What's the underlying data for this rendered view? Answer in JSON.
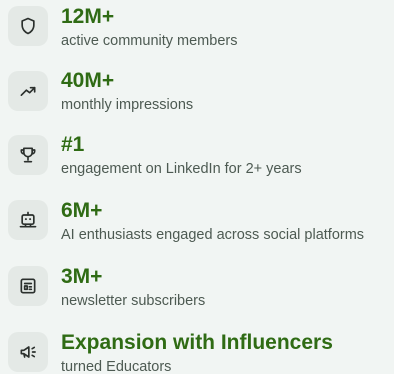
{
  "stats": [
    {
      "icon": "shield-icon",
      "value": "12M+",
      "label": "active community members"
    },
    {
      "icon": "trending-up-icon",
      "value": "40M+",
      "label": "monthly impressions"
    },
    {
      "icon": "trophy-icon",
      "value": "#1",
      "label": "engagement on LinkedIn for 2+ years"
    },
    {
      "icon": "robot-icon",
      "value": "6M+",
      "label": "AI enthusiasts engaged across social platforms"
    },
    {
      "icon": "newspaper-icon",
      "value": "3M+",
      "label": "newsletter subscribers"
    },
    {
      "icon": "megaphone-icon",
      "value": "Expansion with Influencers",
      "label": "turned Educators"
    }
  ],
  "colors": {
    "accent": "#2f6b14",
    "text_muted": "#4d5a52",
    "icon_bg": "#e4e9e6",
    "icon_stroke": "#2b302d",
    "background": "#f1f5f3"
  }
}
